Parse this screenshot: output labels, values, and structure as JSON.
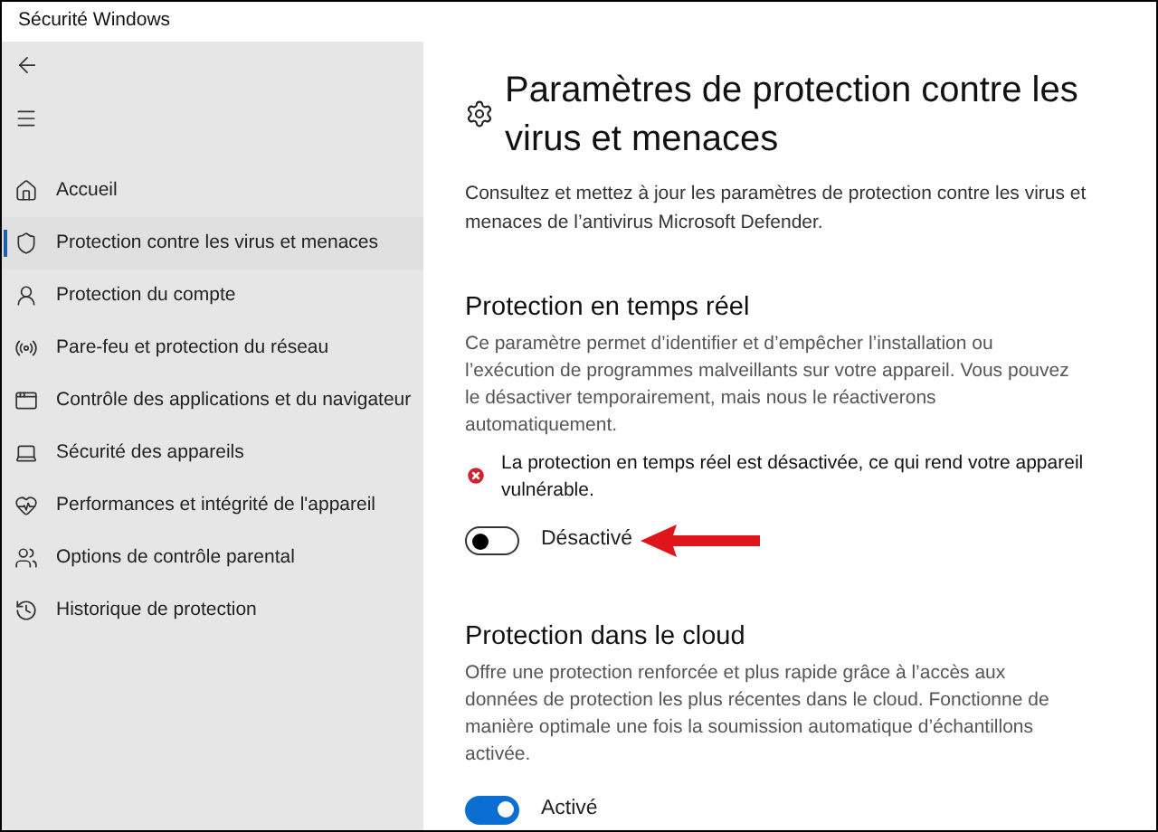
{
  "window": {
    "title": "Sécurité Windows"
  },
  "sidebar": {
    "items": [
      {
        "label": "Accueil",
        "selected": false
      },
      {
        "label": "Protection contre les virus et menaces",
        "selected": true
      },
      {
        "label": "Protection du compte",
        "selected": false
      },
      {
        "label": "Pare-feu et protection du réseau",
        "selected": false
      },
      {
        "label": "Contrôle des applications et du navigateur",
        "selected": false
      },
      {
        "label": "Sécurité des appareils",
        "selected": false
      },
      {
        "label": "Performances et intégrité de l'appareil",
        "selected": false
      },
      {
        "label": "Options de contrôle parental",
        "selected": false
      },
      {
        "label": "Historique de protection",
        "selected": false
      }
    ]
  },
  "page": {
    "title": "Paramètres de protection contre les virus et menaces",
    "description": "Consultez et mettez à jour les paramètres de protection contre les virus et menaces de l’antivirus Microsoft Defender."
  },
  "sections": [
    {
      "title": "Protection en temps réel",
      "description": "Ce paramètre permet d’identifier et d’empêcher l’installation ou l’exécution de programmes malveillants sur votre appareil. Vous pouvez le désactiver temporairement, mais nous le réactiverons automatiquement.",
      "warning": "La protection en temps réel est désactivée, ce qui rend votre appareil vulnérable.",
      "toggle": {
        "on": false,
        "label": "Désactivé"
      },
      "highlighted": true
    },
    {
      "title": "Protection dans le cloud",
      "description": "Offre une protection renforcée et plus rapide grâce à l’accès aux données de protection les plus récentes dans le cloud. Fonctionne de manière optimale une fois la soumission automatique d’échantillons activée.",
      "toggle": {
        "on": true,
        "label": "Activé"
      },
      "highlighted": false
    }
  ]
}
